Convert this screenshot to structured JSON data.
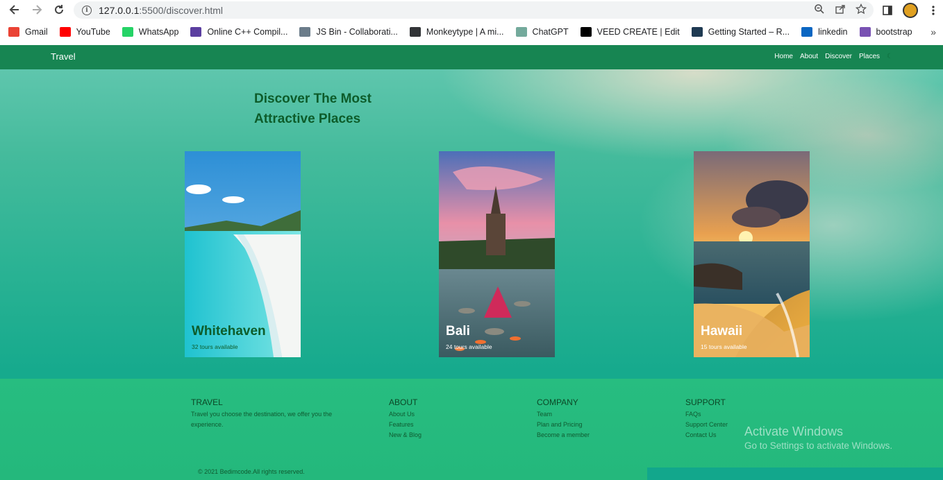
{
  "browser": {
    "url_host": "127.0.0.1",
    "url_path": ":5500/discover.html",
    "bookmarks": [
      {
        "label": "Gmail",
        "icon": "gmail-icon",
        "color": "#ea4335"
      },
      {
        "label": "YouTube",
        "icon": "youtube-icon",
        "color": "#ff0000"
      },
      {
        "label": "WhatsApp",
        "icon": "whatsapp-icon",
        "color": "#25d366"
      },
      {
        "label": "Online C++ Compil...",
        "icon": "replit-icon",
        "color": "#5b3fa0"
      },
      {
        "label": "JS Bin - Collaborati...",
        "icon": "jsbin-icon",
        "color": "#6b7c8a"
      },
      {
        "label": "Monkeytype | A mi...",
        "icon": "monkeytype-icon",
        "color": "#323437"
      },
      {
        "label": "ChatGPT",
        "icon": "chatgpt-icon",
        "color": "#74aa9c"
      },
      {
        "label": "VEED CREATE | Edit",
        "icon": "veed-icon",
        "color": "#000000"
      },
      {
        "label": "Getting Started – R...",
        "icon": "react-icon",
        "color": "#1f3a52"
      },
      {
        "label": "linkedin",
        "icon": "linkedin-icon",
        "color": "#0a66c2"
      },
      {
        "label": "bootstrap",
        "icon": "bootstrap-icon",
        "color": "#7952b3"
      }
    ]
  },
  "site": {
    "logo": "Travel",
    "menu": [
      "Home",
      "About",
      "Discover",
      "Places"
    ],
    "heading": "Discover The Most Attractive Places",
    "cards": [
      {
        "name": "Whitehaven",
        "tours": "32 tours available",
        "text_color": "#0d5c2a"
      },
      {
        "name": "Bali",
        "tours": "24 tours available",
        "text_color": "#ffffff"
      },
      {
        "name": "Hawaii",
        "tours": "15 tours available",
        "text_color": "#ffffff"
      }
    ],
    "footer": {
      "col1": {
        "title": "TRAVEL",
        "text": "Travel you choose the destination, we offer you the experience."
      },
      "col2": {
        "title": "ABOUT",
        "links": [
          "About Us",
          "Features",
          "New & Blog"
        ]
      },
      "col3": {
        "title": "COMPANY",
        "links": [
          "Team",
          "Plan and Pricing",
          "Become a member"
        ]
      },
      "col4": {
        "title": "SUPPORT",
        "links": [
          "FAQs",
          "Support Center",
          "Contact Us"
        ]
      },
      "copyright": "© 2021 Bedimcode.All rights reserved."
    },
    "windows_activation": {
      "title": "Activate Windows",
      "subtitle": "Go to Settings to activate Windows."
    },
    "colors": {
      "header": "#178552",
      "footer": "#27bd80",
      "heading": "#0d5c2a"
    }
  }
}
